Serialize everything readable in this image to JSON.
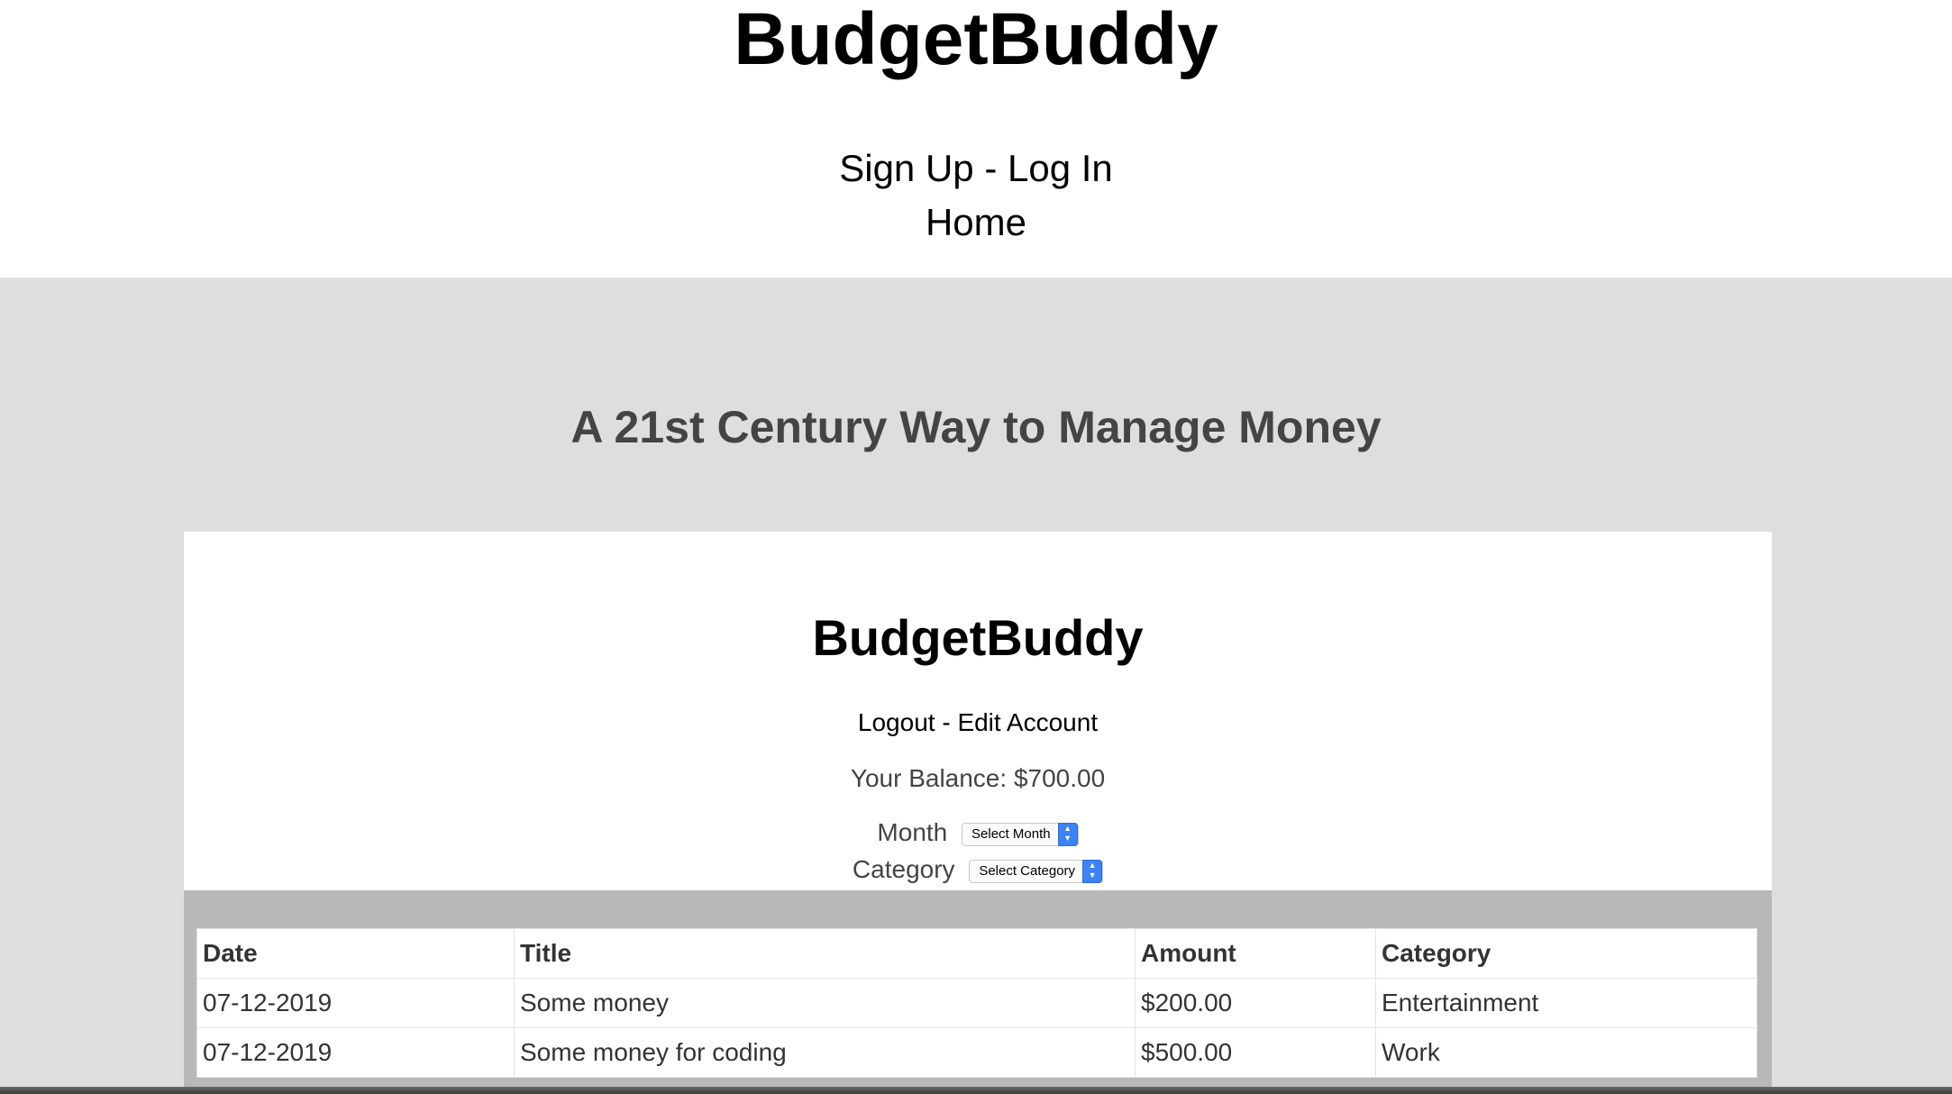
{
  "header": {
    "site_title": "BudgetBuddy",
    "nav_signup": "Sign Up",
    "nav_separator": "-",
    "nav_login": "Log In",
    "nav_home": "Home"
  },
  "hero": {
    "tagline": "A 21st Century Way to Manage Money"
  },
  "app": {
    "title": "BudgetBuddy",
    "logout": "Logout",
    "separator": "-",
    "edit_account": "Edit Account",
    "balance": "Your Balance: $700.00",
    "month_label": "Month",
    "month_select": "Select Month",
    "category_label": "Category",
    "category_select": "Select Category"
  },
  "table": {
    "headers": [
      "Date",
      "Title",
      "Amount",
      "Category"
    ],
    "rows": [
      [
        "07-12-2019",
        "Some money",
        "$200.00",
        "Entertainment"
      ],
      [
        "07-12-2019",
        "Some money for coding",
        "$500.00",
        "Work"
      ]
    ]
  },
  "colors": {
    "hero_bg": "#dedede",
    "table_panel_bg": "#b8b8b8",
    "select_accent": "#3b82f6"
  }
}
